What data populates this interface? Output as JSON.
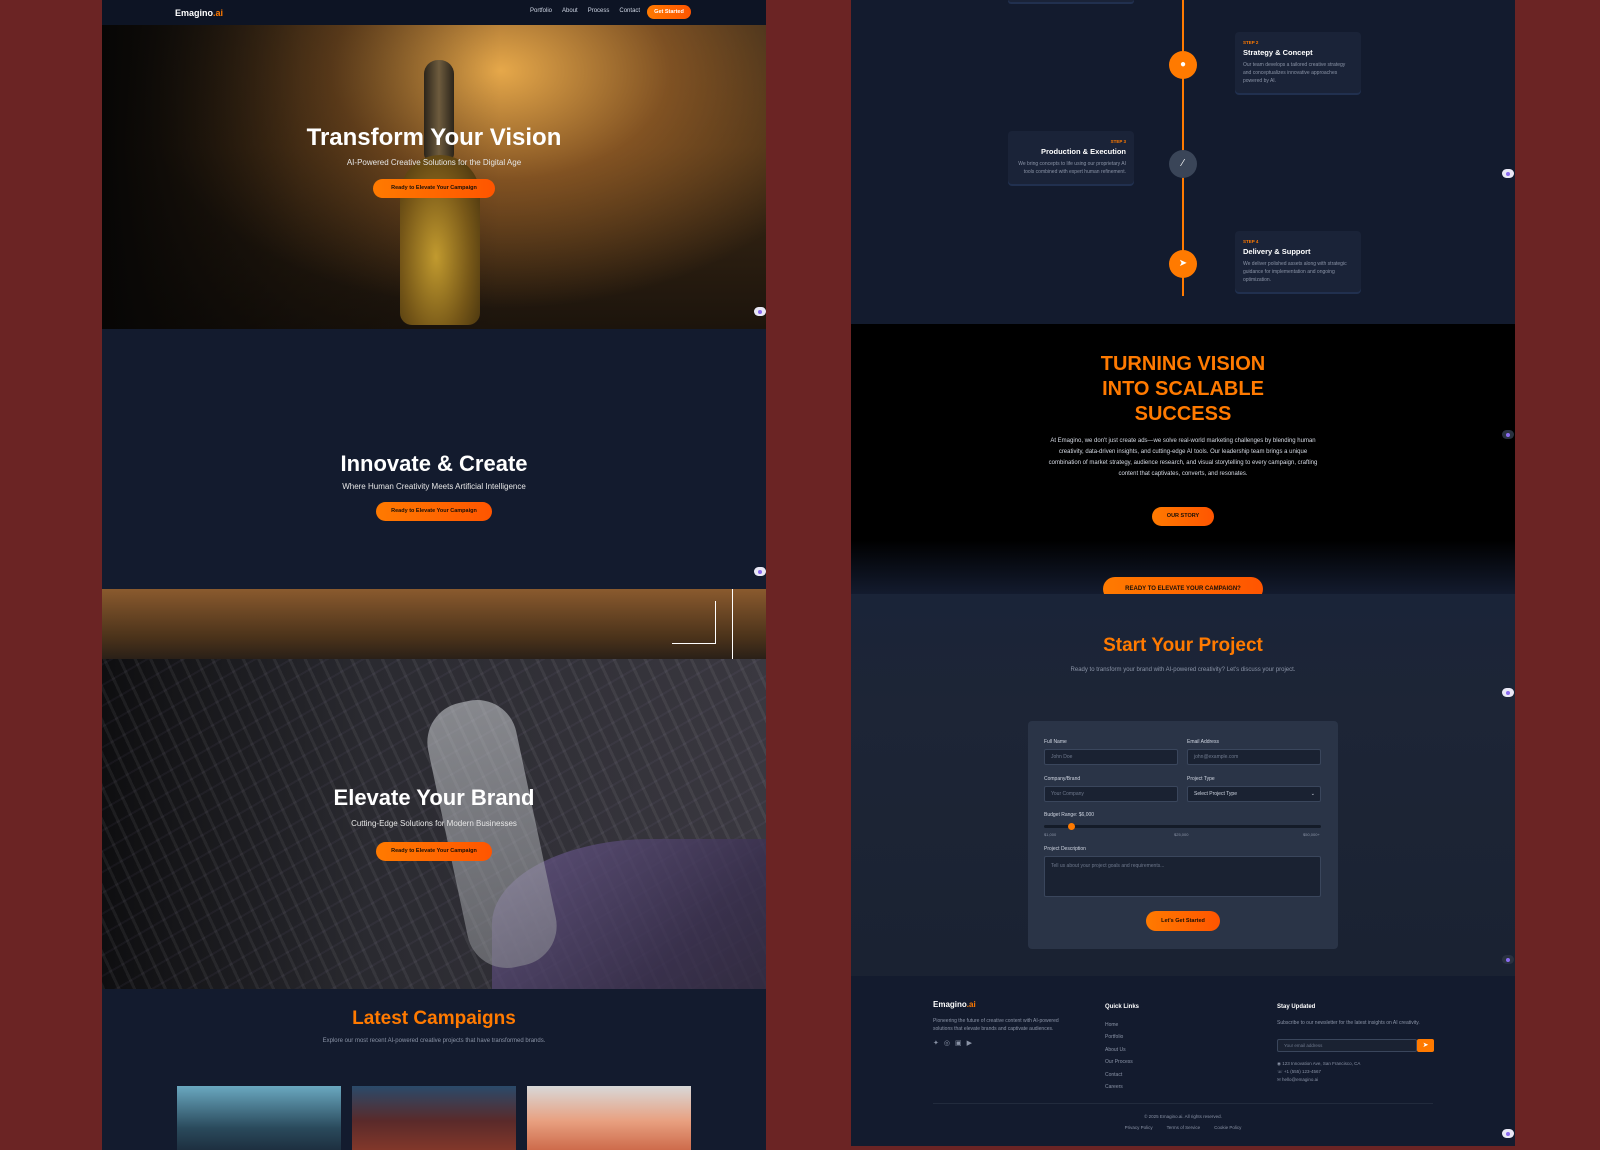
{
  "nav": {
    "logo": "Emagino",
    "logo_suffix": ".ai",
    "links": [
      "Portfolio",
      "About",
      "Process",
      "Contact"
    ],
    "cta": "Get Started"
  },
  "hero": {
    "title": "Transform Your Vision",
    "subtitle": "AI-Powered Creative Solutions for the Digital Age",
    "cta": "Ready to Elevate Your Campaign"
  },
  "innovate": {
    "title": "Innovate & Create",
    "subtitle": "Where Human Creativity Meets Artificial Intelligence",
    "cta": "Ready to Elevate Your Campaign"
  },
  "elevate": {
    "title": "Elevate Your Brand",
    "subtitle": "Cutting-Edge Solutions for Modern Businesses",
    "cta": "Ready to Elevate Your Campaign"
  },
  "latest": {
    "title": "Latest Campaigns",
    "desc": "Explore our most recent AI-powered creative projects that have transformed brands."
  },
  "process": {
    "steps": [
      {
        "step": "STEP 2",
        "title": "Strategy & Concept",
        "desc": "Our team develops a tailored creative strategy and conceptualizes innovative approaches powered by AI.",
        "icon": "lightbulb-icon"
      },
      {
        "step": "STEP 3",
        "title": "Production & Execution",
        "desc": "We bring concepts to life using our proprietary AI tools combined with expert human refinement.",
        "icon": "magic-wand-icon"
      },
      {
        "step": "STEP 4",
        "title": "Delivery & Support",
        "desc": "We deliver polished assets along with strategic guidance for implementation and ongoing optimization.",
        "icon": "rocket-icon"
      }
    ]
  },
  "vision": {
    "title_l1": "TURNING VISION",
    "title_l2": "INTO SCALABLE",
    "title_l3": "SUCCESS",
    "body": "At Emagino, we don't just create ads—we solve real-world marketing challenges by blending human creativity, data-driven insights, and cutting-edge AI tools. Our leadership team brings a unique combination of market strategy, audience research, and visual storytelling to every campaign, crafting content that captivates, converts, and resonates.",
    "story_cta": "OUR STORY",
    "elevate_cta": "READY TO ELEVATE YOUR CAMPAIGN?"
  },
  "project": {
    "title": "Start Your Project",
    "desc": "Ready to transform your brand with AI-powered creativity? Let's discuss your project.",
    "full_name_label": "Full Name",
    "full_name_ph": "John Doe",
    "email_label": "Email Address",
    "email_ph": "john@example.com",
    "company_label": "Company/Brand",
    "company_ph": "Your Company",
    "type_label": "Project Type",
    "type_value": "Select Project Type",
    "budget_label": "Budget Range: $6,000",
    "budget_fraction": 0.1,
    "budget_min": "$1,000",
    "budget_mid": "$25,000",
    "budget_max": "$50,000+",
    "desc_label": "Project Description",
    "desc_ph": "Tell us about your project goals and requirements...",
    "submit": "Let's Get Started"
  },
  "footer": {
    "logo": "Emagino",
    "logo_suffix": ".ai",
    "tagline": "Pioneering the future of creative content with AI-powered solutions that elevate brands and captivate audiences.",
    "quick_title": "Quick Links",
    "quick_links": [
      "Home",
      "Portfolio",
      "About Us",
      "Our Process",
      "Contact",
      "Careers"
    ],
    "stay_title": "Stay Updated",
    "stay_desc": "Subscribe to our newsletter for the latest insights on AI creativity.",
    "email_ph": "Your email address",
    "address": "123 Innovation Ave, San Francisco, CA",
    "phone": "+1 (555) 123-4567",
    "email": "hello@emagino.ai",
    "copyright": "© 2025 Emagino.ai. All rights reserved.",
    "legal": [
      "Privacy Policy",
      "Terms of Service",
      "Cookie Policy"
    ]
  },
  "colors": {
    "accent": "#ff7a00",
    "panel": "#131b2e",
    "page": "#6b2424"
  }
}
